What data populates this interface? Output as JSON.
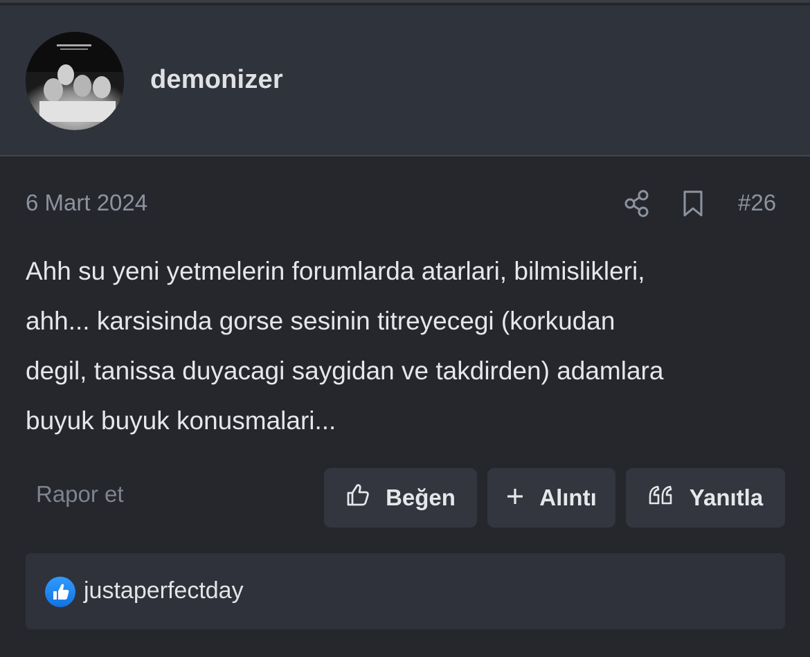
{
  "user": {
    "username": "demonizer",
    "avatar_icon": "user-avatar-image"
  },
  "post": {
    "date": "6 Mart 2024",
    "number": "#26",
    "body": "Ahh su yeni yetmelerin forumlarda atarlari, bilmislikleri,\nahh... karsisinda gorse sesinin titreyecegi (korkudan\ndegil, tanissa duyacagi saygidan ve takdirden) adamlara\nbuyuk buyuk konusmalari..."
  },
  "actions": {
    "report_label": "Rapor et",
    "like_label": "Beğen",
    "quote_label": "Alıntı",
    "reply_label": "Yanıtla"
  },
  "icons": {
    "share": "share-icon",
    "bookmark": "bookmark-icon",
    "like": "thumbs-up-icon",
    "quote": "plus-icon",
    "reply": "quote-marks-icon"
  },
  "reactions": {
    "icon": "like-reaction-icon",
    "users": [
      "justaperfectday"
    ]
  },
  "colors": {
    "page_background": "#25272d",
    "header_background": "#2f333b",
    "button_background": "#33363e",
    "reaction_badge": "#1f86f5",
    "muted_text": "#8d939e",
    "primary_text": "#e6e7ea"
  }
}
